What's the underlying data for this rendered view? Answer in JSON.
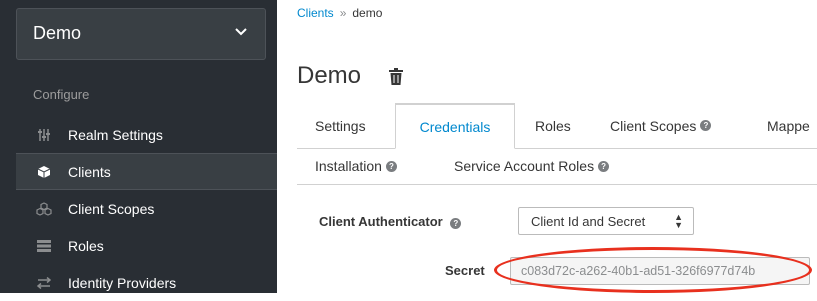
{
  "sidebar": {
    "realm_name": "Demo",
    "section_label": "Configure",
    "items": [
      {
        "label": "Realm Settings",
        "icon": "sliders-icon",
        "active": false
      },
      {
        "label": "Clients",
        "icon": "cube-icon",
        "active": true
      },
      {
        "label": "Client Scopes",
        "icon": "cubes-icon",
        "active": false
      },
      {
        "label": "Roles",
        "icon": "list-icon",
        "active": false
      },
      {
        "label": "Identity Providers",
        "icon": "exchange-icon",
        "active": false
      }
    ]
  },
  "breadcrumb": {
    "parent": "Clients",
    "separator": "»",
    "current": "demo"
  },
  "page": {
    "title": "Demo"
  },
  "tabs_row1": [
    {
      "label": "Settings",
      "active": false,
      "help": false
    },
    {
      "label": "Credentials",
      "active": true,
      "help": false
    },
    {
      "label": "Roles",
      "active": false,
      "help": false
    },
    {
      "label": "Client Scopes",
      "active": false,
      "help": true
    },
    {
      "label": "Mappe",
      "active": false,
      "help": false
    }
  ],
  "tabs_row2": [
    {
      "label": "Installation",
      "help": true
    },
    {
      "label": "Service Account Roles",
      "help": true
    }
  ],
  "form": {
    "authenticator_label": "Client Authenticator",
    "authenticator_value": "Client Id and Secret",
    "secret_label": "Secret",
    "secret_value": "c083d72c-a262-40b1-ad51-326f6977d74b"
  },
  "colors": {
    "link": "#0088ce",
    "sidebar_bg": "#292e34",
    "highlight": "#e8301e"
  }
}
